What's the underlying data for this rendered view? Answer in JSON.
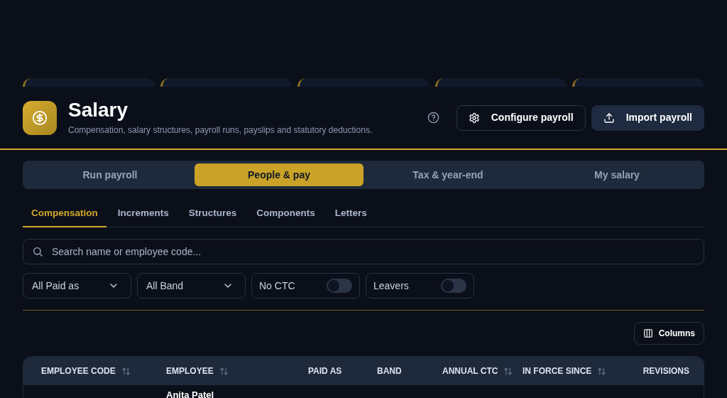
{
  "header": {
    "title": "Salary",
    "subtitle": "Compensation, salary structures, payroll runs, payslips and statutory deductions.",
    "buttons": [
      {
        "label": "Configure payroll",
        "kind": "outline"
      },
      {
        "label": "Import payroll",
        "kind": "filled"
      }
    ]
  },
  "tabs": [
    {
      "label": "Run payroll",
      "selected": false
    },
    {
      "label": "People & pay",
      "selected": true
    },
    {
      "label": "Tax & year-end",
      "selected": false
    },
    {
      "label": "My salary",
      "selected": false
    }
  ],
  "subtabs": [
    {
      "label": "Compensation",
      "selected": true
    },
    {
      "label": "Increments",
      "selected": false
    },
    {
      "label": "Structures",
      "selected": false
    },
    {
      "label": "Components",
      "selected": false
    },
    {
      "label": "Letters",
      "selected": false
    }
  ],
  "search": {
    "placeholder": "Search name or employee code..."
  },
  "filters": [
    {
      "kind": "select",
      "label": "All Paid as"
    },
    {
      "kind": "select",
      "label": "All Band"
    },
    {
      "kind": "toggle",
      "label": "No CTC",
      "on": false
    },
    {
      "kind": "toggle",
      "label": "Leavers",
      "on": false
    }
  ],
  "columns_button": {
    "label": "Columns"
  },
  "table": {
    "columns": [
      {
        "label": "EMPLOYEE CODE",
        "sortable": true
      },
      {
        "label": "EMPLOYEE",
        "sortable": true
      },
      {
        "label": "PAID AS",
        "sortable": false
      },
      {
        "label": "BAND",
        "sortable": false
      },
      {
        "label": "ANNUAL CTC",
        "sortable": true
      },
      {
        "label": "IN FORCE SINCE",
        "sortable": true
      },
      {
        "label": "REVISIONS",
        "sortable": false
      }
    ],
    "rows": [
      {
        "employee": "Anita Patel"
      }
    ]
  }
}
